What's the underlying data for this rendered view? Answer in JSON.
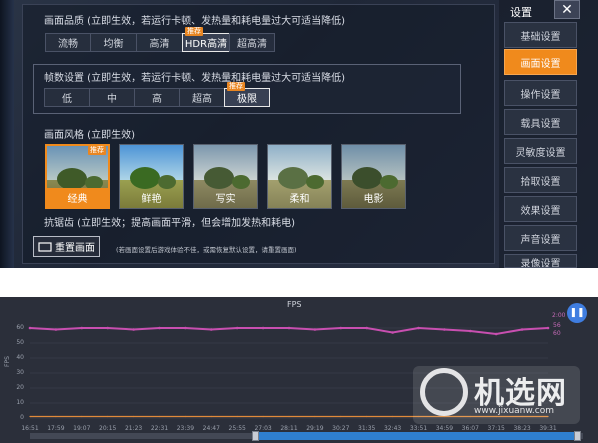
{
  "settings": {
    "title": "设置",
    "close_icon": "close-icon",
    "quality": {
      "label": "画面品质 (立即生效，若运行卡顿、发热量和耗电量过大可适当降低)",
      "options": [
        "流畅",
        "均衡",
        "高清",
        "HDR高清",
        "超高清"
      ],
      "selected": "HDR高清",
      "badge": "推荐"
    },
    "framerate": {
      "label": "帧数设置 (立即生效，若运行卡顿、发热量和耗电量过大可适当降低)",
      "options": [
        "低",
        "中",
        "高",
        "超高",
        "极限"
      ],
      "selected": "极限",
      "badge": "推荐"
    },
    "style": {
      "label": "画面风格 (立即生效)",
      "options": [
        "经典",
        "鲜艳",
        "写实",
        "柔和",
        "电影"
      ],
      "selected": "经典",
      "badge": "推荐"
    },
    "antialias_label": "抗锯齿 (立即生效；提高画面平滑，但会增加发热和耗电)",
    "reset_button": "重置画面",
    "reset_note": "(若画面设置后游戏体验不佳，或需恢复默认设置，请重置画面)",
    "nav": [
      "基础设置",
      "画面设置",
      "操作设置",
      "载具设置",
      "灵敏度设置",
      "拾取设置",
      "效果设置",
      "声音设置",
      "录像设置"
    ],
    "nav_active": "画面设置"
  },
  "fps_panel": {
    "title": "FPS",
    "pause_icon": "pause-icon",
    "y_axis_label": "FPS",
    "right_labels": [
      "2:00",
      "56",
      "60"
    ],
    "watermark_text": "机选网",
    "watermark_url": "www.jixuanw.com"
  },
  "chart_data": {
    "type": "line",
    "title": "FPS",
    "ylabel": "FPS",
    "ylim": [
      0,
      70
    ],
    "y_ticks": [
      0,
      10,
      20,
      30,
      40,
      50,
      60
    ],
    "x_ticks": [
      "16:51",
      "17:59",
      "19:07",
      "20:15",
      "21:23",
      "22:31",
      "23:39",
      "24:47",
      "25:55",
      "27:03",
      "28:11",
      "29:19",
      "30:27",
      "31:35",
      "32:43",
      "33:51",
      "34:59",
      "36:07",
      "37:15",
      "38:23",
      "39:31"
    ],
    "series": [
      {
        "color": "#c84fb0",
        "values": [
          60,
          59,
          60,
          60,
          59,
          60,
          60,
          59,
          60,
          60,
          60,
          59,
          60,
          60,
          57,
          60,
          59,
          58,
          56,
          59,
          60
        ]
      },
      {
        "color": "#e08a3a",
        "values": [
          1,
          1,
          1,
          1,
          1,
          1,
          1,
          1,
          1,
          1,
          1,
          1,
          1,
          1,
          1,
          1,
          1,
          1,
          1,
          1,
          1
        ]
      }
    ]
  }
}
